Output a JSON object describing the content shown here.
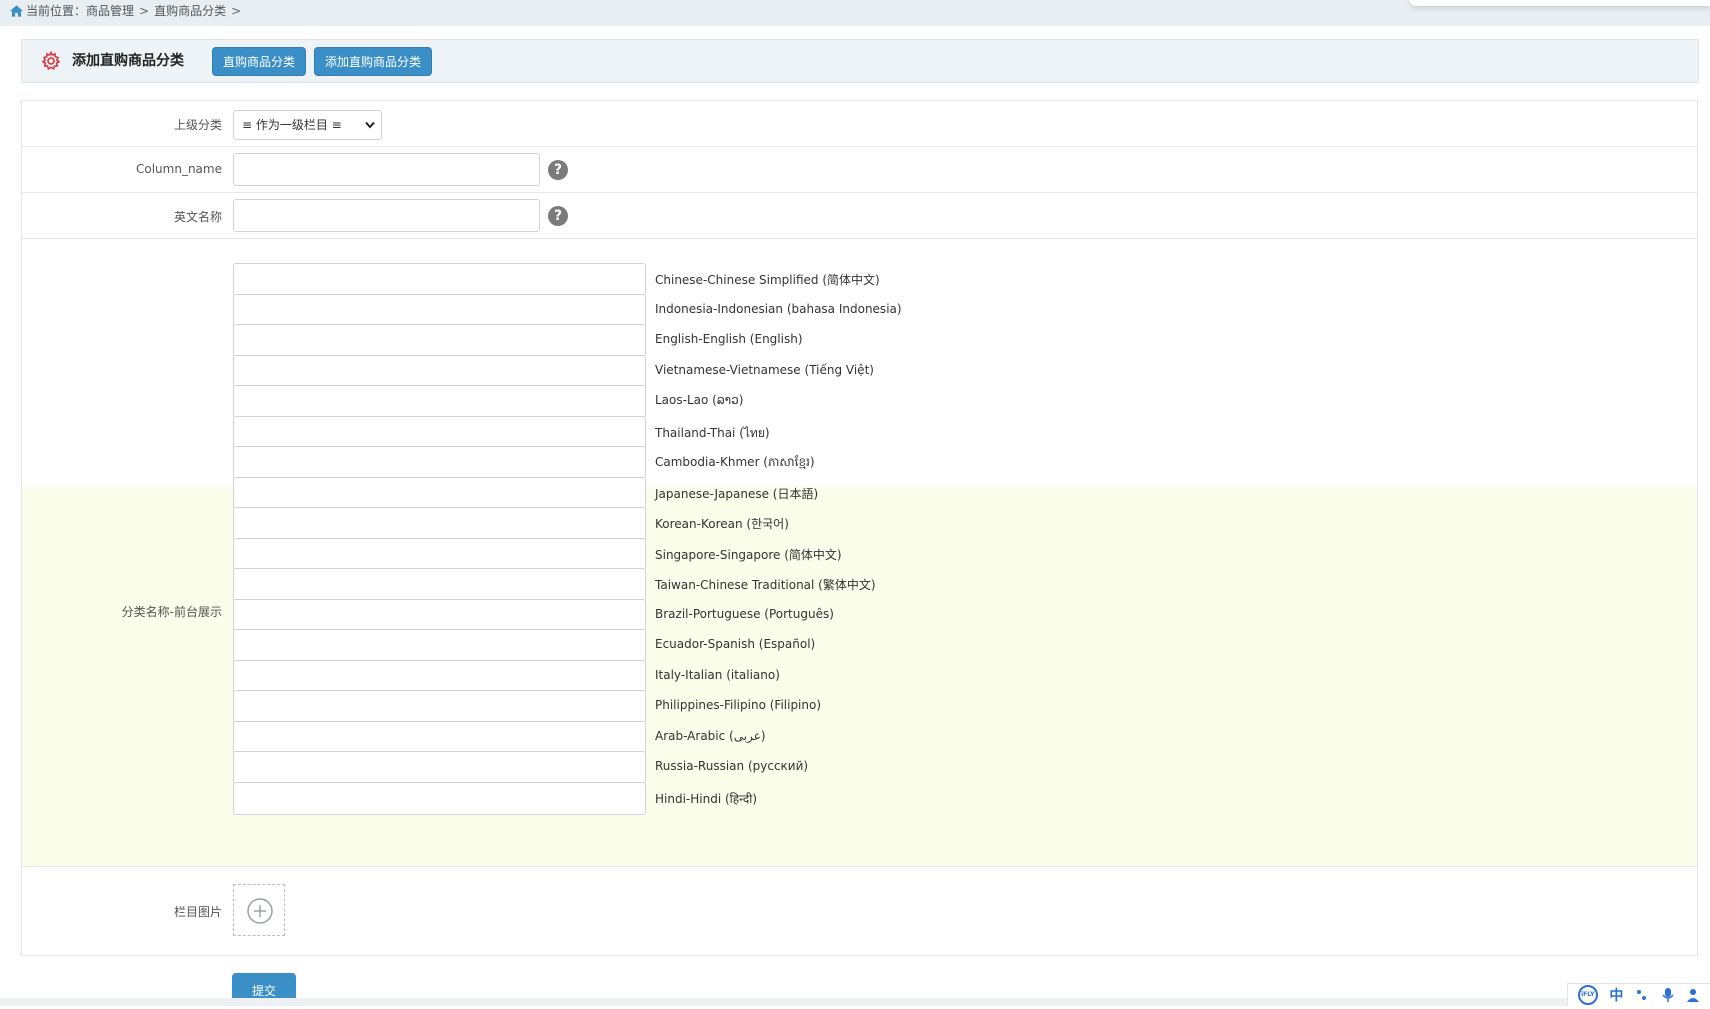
{
  "breadcrumb": {
    "prefix": "当前位置：",
    "items": [
      "商品管理",
      "直购商品分类"
    ],
    "separator": ">"
  },
  "titlebar": {
    "title": "添加直购商品分类",
    "buttons": [
      "直购商品分类",
      "添加直购商品分类"
    ]
  },
  "form": {
    "parent_label": "上级分类",
    "parent_value": "≡ 作为一级栏目 ≡",
    "column_name_label": "Column_name",
    "column_name_value": "",
    "english_name_label": "英文名称",
    "english_name_value": "",
    "display_name_label": "分类名称-前台展示",
    "languages": [
      {
        "label": "Chinese-Chinese Simplified (简体中文)",
        "value": ""
      },
      {
        "label": "Indonesia-Indonesian (bahasa Indonesia)",
        "value": ""
      },
      {
        "label": "English-English (English)",
        "value": ""
      },
      {
        "label": "Vietnamese-Vietnamese (Tiếng Việt)",
        "value": ""
      },
      {
        "label": "Laos-Lao (ລາວ)",
        "value": ""
      },
      {
        "label": "Thailand-Thai (ไทย)",
        "value": ""
      },
      {
        "label": "Cambodia-Khmer (ភាសាខ្មែរ)",
        "value": ""
      },
      {
        "label": "Japanese-Japanese (日本語)",
        "value": ""
      },
      {
        "label": "Korean-Korean (한국어)",
        "value": ""
      },
      {
        "label": "Singapore-Singapore  (简体中文)",
        "value": ""
      },
      {
        "label": "Taiwan-Chinese Traditional (繁体中文)",
        "value": ""
      },
      {
        "label": "Brazil-Portuguese (Português)",
        "value": ""
      },
      {
        "label": "Ecuador-Spanish (Español)",
        "value": ""
      },
      {
        "label": "Italy-Italian (italiano)",
        "value": ""
      },
      {
        "label": "Philippines-Filipino (Filipino)",
        "value": ""
      },
      {
        "label": "Arab-Arabic (عربى)",
        "value": ""
      },
      {
        "label": "Russia-Russian (русский)",
        "value": ""
      },
      {
        "label": "Hindi-Hindi (हिन्दी)",
        "value": ""
      }
    ],
    "image_label": "栏目图片",
    "submit_label": "提交"
  },
  "ime": {
    "logo": "iFLY",
    "mode": "中"
  },
  "colors": {
    "accent": "#3b8fc7",
    "highlight_bg": "#f9fdea",
    "gear": "#d9363e"
  }
}
